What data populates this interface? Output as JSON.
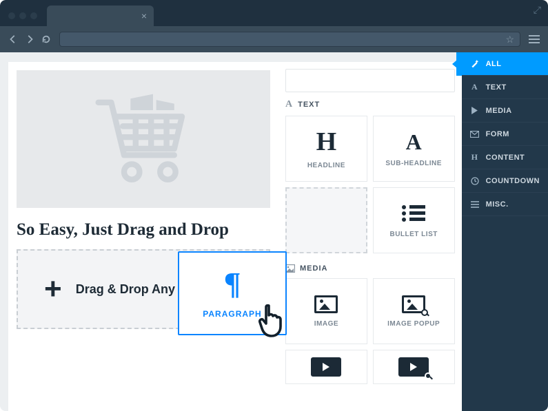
{
  "canvas": {
    "headline": "So Easy, Just Drag and Drop",
    "dropzone_plus": "+",
    "dropzone_msg": "Drag & Drop Any"
  },
  "dragging": {
    "label": "PARAGRAPH"
  },
  "panel": {
    "sections": {
      "text": {
        "title": "TEXT"
      },
      "media": {
        "title": "MEDIA"
      }
    },
    "tiles": {
      "headline": "HEADLINE",
      "subheadline": "SUB-HEADLINE",
      "bulletlist": "BULLET LIST",
      "image": "IMAGE",
      "imagepopup": "IMAGE POPUP"
    }
  },
  "rail": {
    "items": [
      {
        "label": "ALL"
      },
      {
        "label": "TEXT"
      },
      {
        "label": "MEDIA"
      },
      {
        "label": "FORM"
      },
      {
        "label": "CONTENT"
      },
      {
        "label": "COUNTDOWN"
      },
      {
        "label": "MISC."
      }
    ]
  }
}
